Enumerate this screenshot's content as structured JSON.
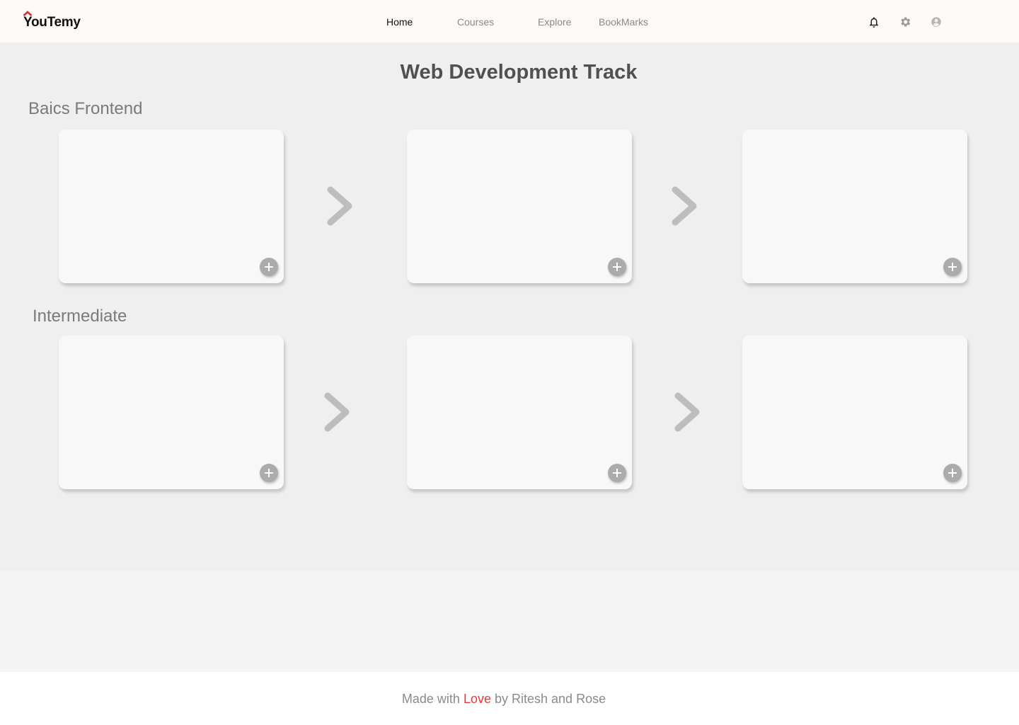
{
  "brand": {
    "name": "YouTemy",
    "accent": "#d32f2f"
  },
  "nav": [
    {
      "label": "Home",
      "active": true
    },
    {
      "label": "Courses",
      "active": false
    },
    {
      "label": "Explore",
      "active": false
    },
    {
      "label": "BookMarks",
      "active": false
    }
  ],
  "header_icons": [
    "bell-icon",
    "gear-icon",
    "user-avatar-icon"
  ],
  "page": {
    "title": "Web Development Track"
  },
  "sections": [
    {
      "title": "Baics Frontend",
      "cards": 3
    },
    {
      "title": "Intermediate",
      "cards": 3
    }
  ],
  "footer": {
    "prefix": "Made with ",
    "love": "Love",
    "suffix": " by Ritesh and Rose",
    "love_color": "#e53935"
  }
}
